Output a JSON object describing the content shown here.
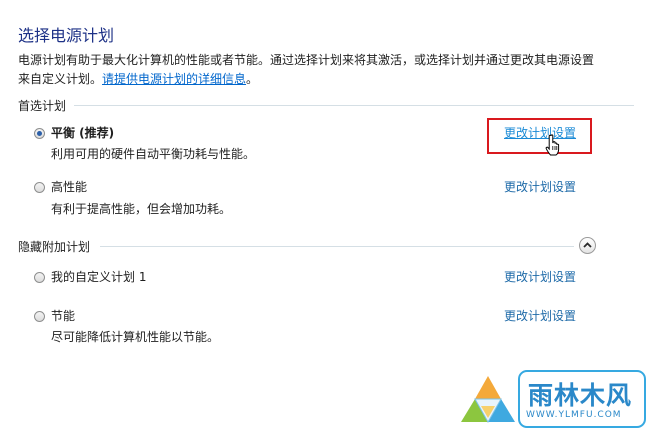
{
  "header": {
    "title": "选择电源计划",
    "description_line1": "电源计划有助于最大化计算机的性能或者节能。通过选择计划来将其激活，或选择计划并通过更改其电源设置",
    "description_line2_prefix": "来自定义计划。",
    "description_link": "请提供电源计划的详细信息",
    "description_line2_suffix": "。"
  },
  "preferred": {
    "label": "首选计划",
    "plans": [
      {
        "name": "平衡 (推荐)",
        "description": "利用可用的硬件自动平衡功耗与性能。",
        "selected": true,
        "change_label": "更改计划设置"
      },
      {
        "name": "高性能",
        "description": "有利于提高性能，但会增加功耗。",
        "selected": false,
        "change_label": "更改计划设置"
      }
    ]
  },
  "hidden": {
    "label": "隐藏附加计划",
    "plans": [
      {
        "name": "我的自定义计划 1",
        "description": "",
        "selected": false,
        "change_label": "更改计划设置"
      },
      {
        "name": "节能",
        "description": "尽可能降低计算机性能以节能。",
        "selected": false,
        "change_label": "更改计划设置"
      }
    ]
  },
  "watermark": {
    "text": "雨林木风",
    "url": "WWW.YLMFU.COM"
  },
  "icons": {
    "collapse": "chevron-up-icon",
    "cursor": "hand-cursor-icon",
    "logo": "ylmf-logo-icon"
  },
  "colors": {
    "title": "#1e3287",
    "link": "#1e6aa8",
    "highlight": "#d9191e",
    "watermark": "#2a88c9"
  }
}
